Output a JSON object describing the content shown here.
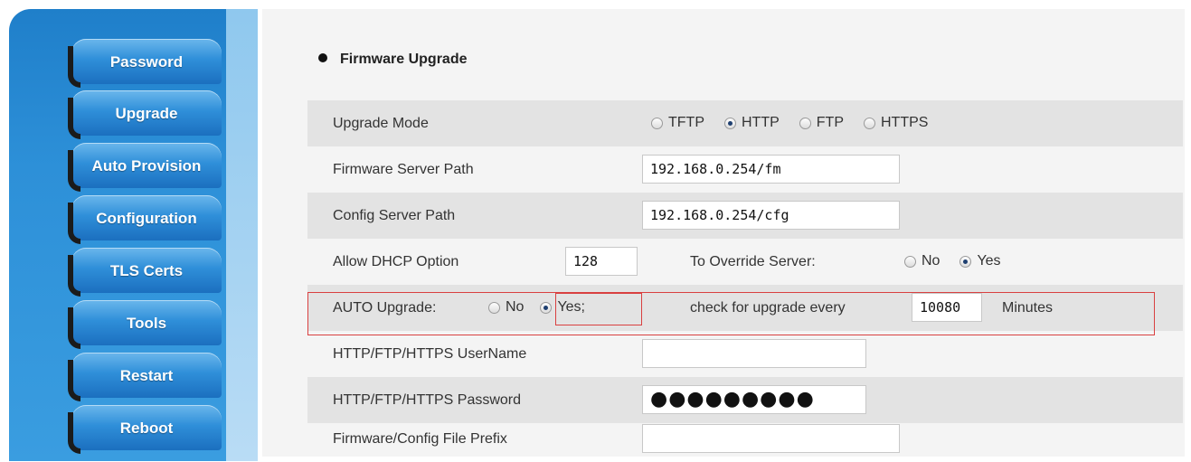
{
  "sidebar": {
    "items": [
      {
        "label": "Password"
      },
      {
        "label": "Upgrade"
      },
      {
        "label": "Auto Provision"
      },
      {
        "label": "Configuration"
      },
      {
        "label": "TLS Certs"
      },
      {
        "label": "Tools"
      },
      {
        "label": "Restart"
      },
      {
        "label": "Reboot"
      }
    ]
  },
  "section": {
    "title": "Firmware Upgrade"
  },
  "form": {
    "upgrade_mode": {
      "label": "Upgrade Mode",
      "options": [
        "TFTP",
        "HTTP",
        "FTP",
        "HTTPS"
      ],
      "selected": "HTTP"
    },
    "firmware_server_path": {
      "label": "Firmware Server Path",
      "value": "192.168.0.254/fm"
    },
    "config_server_path": {
      "label": "Config Server Path",
      "value": "192.168.0.254/cfg"
    },
    "dhcp_option": {
      "label": "Allow DHCP Option",
      "value": "128",
      "override_label": "To Override Server:",
      "override_options": [
        "No",
        "Yes"
      ],
      "override_selected": "Yes"
    },
    "auto_upgrade": {
      "label": "AUTO Upgrade:",
      "options": [
        "No",
        "Yes;"
      ],
      "selected": "Yes;",
      "check_label": "check for upgrade every",
      "interval": "10080",
      "unit": "Minutes"
    },
    "username": {
      "label": "HTTP/FTP/HTTPS UserName",
      "value": ""
    },
    "password": {
      "label": "HTTP/FTP/HTTPS Password",
      "value": "●●●●●●●●●"
    },
    "file_prefix": {
      "label": "Firmware/Config File Prefix",
      "value": ""
    }
  },
  "colors": {
    "highlight": "#d94040",
    "row_shade": "#e3e3e3",
    "nav_blue": "#2f8fd9"
  }
}
